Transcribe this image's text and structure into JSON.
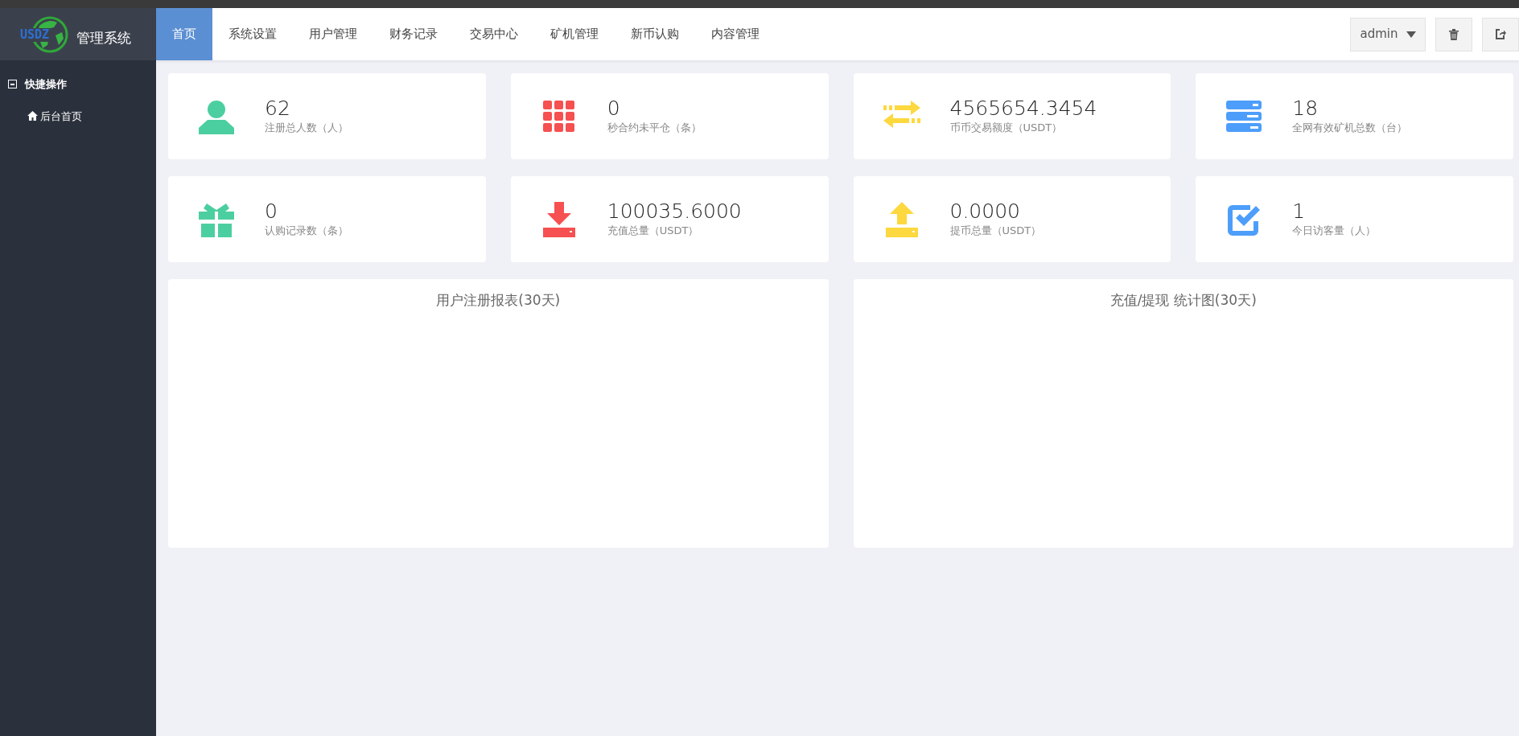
{
  "logo": {
    "mark": "USDZ",
    "title": "管理系统"
  },
  "sidebar": {
    "items": [
      {
        "label": "快捷操作",
        "expanded": true,
        "children": [
          {
            "label": "后台首页"
          }
        ]
      }
    ]
  },
  "nav": {
    "tabs": [
      {
        "label": "首页",
        "selected": true
      },
      {
        "label": "系统设置",
        "selected": false
      },
      {
        "label": "用户管理",
        "selected": false
      },
      {
        "label": "财务记录",
        "selected": false
      },
      {
        "label": "交易中心",
        "selected": false
      },
      {
        "label": "矿机管理",
        "selected": false
      },
      {
        "label": "新币认购",
        "selected": false
      },
      {
        "label": "内容管理",
        "selected": false
      }
    ],
    "user": "admin"
  },
  "stats": [
    {
      "kind": "person",
      "color": "#4ccfa0",
      "value": "62",
      "label": "注册总人数（人）"
    },
    {
      "kind": "grid",
      "color": "#f65050",
      "value": "0",
      "label": "秒合约未平仓（条）"
    },
    {
      "kind": "exchange",
      "color": "#fdd83e",
      "value": "4565654.3454",
      "label": "币币交易额度（USDT）"
    },
    {
      "kind": "server",
      "color": "#4d9efa",
      "value": "18",
      "label": "全网有效矿机总数（台）"
    },
    {
      "kind": "gift",
      "color": "#4ccfa0",
      "value": "0",
      "label": "认购记录数（条）"
    },
    {
      "kind": "download",
      "color": "#f65050",
      "value": "100035.6000",
      "label": "充值总量（USDT）"
    },
    {
      "kind": "upload",
      "color": "#fdd83e",
      "value": "0.0000",
      "label": "提币总量（USDT）"
    },
    {
      "kind": "check",
      "color": "#4d9efa",
      "value": "1",
      "label": "今日访客量（人）"
    }
  ],
  "panels": [
    {
      "title": "用户注册报表(30天)"
    },
    {
      "title": "充值/提现 统计图(30天)"
    }
  ]
}
